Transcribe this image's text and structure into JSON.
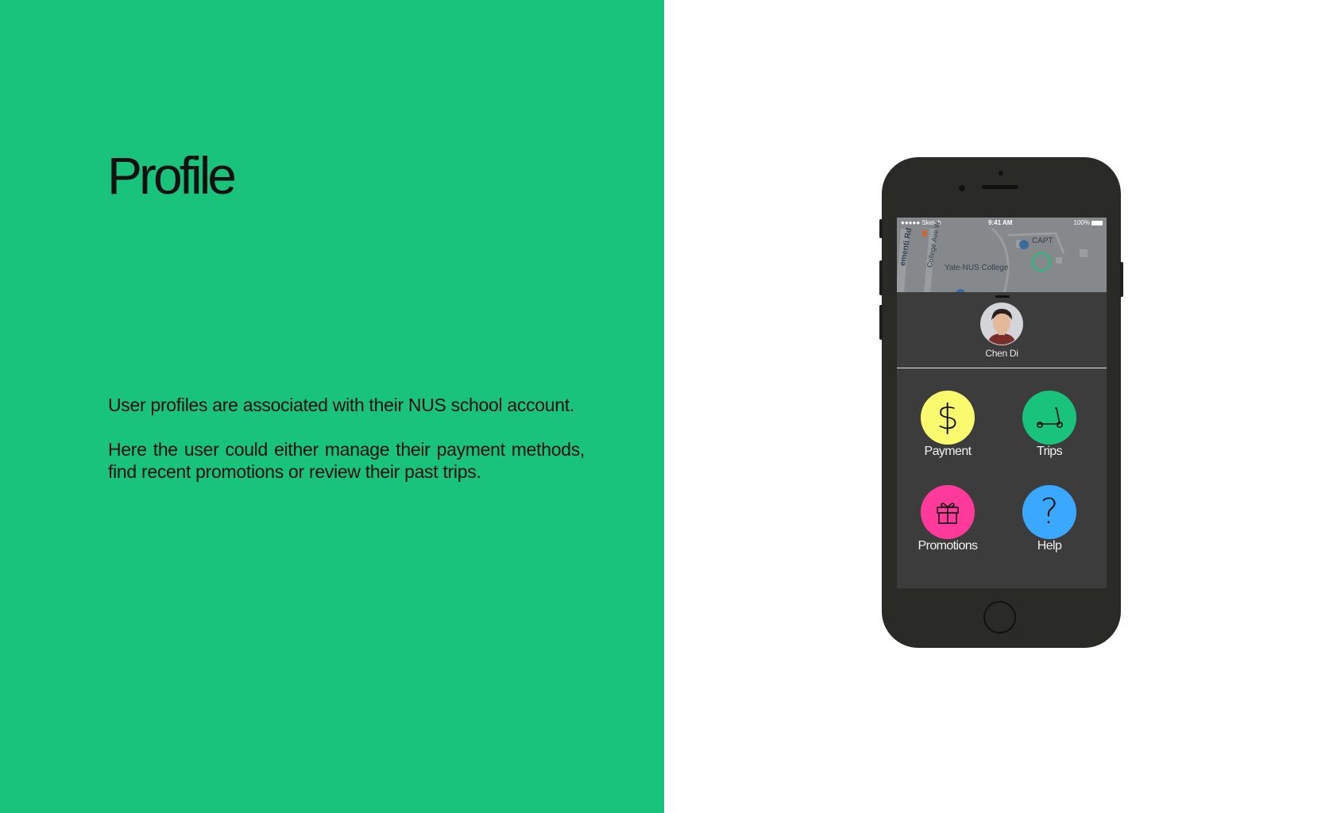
{
  "slide": {
    "title": "Profile",
    "paragraph_1": "User profiles are associated with their NUS school account.",
    "paragraph_2": "Here the user could either manage their payment methods, find recent promotions or review their past trips."
  },
  "colors": {
    "brand_green": "#19c37b",
    "payment_yellow": "#fafa6e",
    "trips_green": "#19c37b",
    "promotions_pink": "#ff3a9a",
    "help_blue": "#3ba8ff"
  },
  "phone": {
    "status_bar": {
      "carrier": "●●●●● Sketch",
      "time": "9:41 AM",
      "battery": "100%"
    },
    "map": {
      "labels": [
        "ementi Rd",
        "College Ave W",
        "CAPT",
        "Yale-NUS College"
      ]
    },
    "profile": {
      "user_name": "Chen Di"
    },
    "menu": [
      {
        "label": "Payment",
        "icon": "dollar-icon"
      },
      {
        "label": "Trips",
        "icon": "scooter-icon"
      },
      {
        "label": "Promotions",
        "icon": "gift-icon"
      },
      {
        "label": "Help",
        "icon": "question-icon"
      }
    ]
  }
}
